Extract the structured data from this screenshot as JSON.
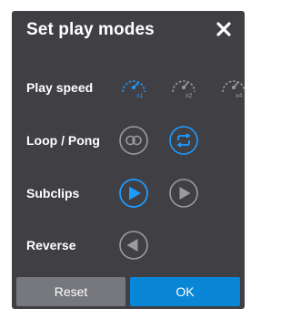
{
  "dialog": {
    "title": "Set play modes",
    "close_icon": "close-icon"
  },
  "rows": {
    "play_speed": {
      "label": "Play speed",
      "options": [
        {
          "icon": "speed-gauge-icon",
          "sublabel": "x1",
          "selected": true
        },
        {
          "icon": "speed-gauge-icon",
          "sublabel": "x2",
          "selected": false
        },
        {
          "icon": "speed-gauge-icon",
          "sublabel": "x4",
          "selected": false
        }
      ]
    },
    "loop_pong": {
      "label": "Loop / Pong",
      "options": [
        {
          "icon": "pong-icon",
          "selected": false
        },
        {
          "icon": "loop-icon",
          "selected": true
        }
      ]
    },
    "subclips": {
      "label": "Subclips",
      "options": [
        {
          "icon": "play-forward-icon",
          "selected": true
        },
        {
          "icon": "play-forward-icon",
          "selected": false
        }
      ]
    },
    "reverse": {
      "label": "Reverse",
      "options": [
        {
          "icon": "play-reverse-icon",
          "selected": false
        }
      ]
    }
  },
  "footer": {
    "reset_label": "Reset",
    "ok_label": "OK"
  },
  "colors": {
    "panel": "#3f3f44",
    "accent": "#0a86d6",
    "accent_icon": "#1e9bff",
    "inactive_icon": "#9a9a9f",
    "reset_bg": "#77787d"
  }
}
